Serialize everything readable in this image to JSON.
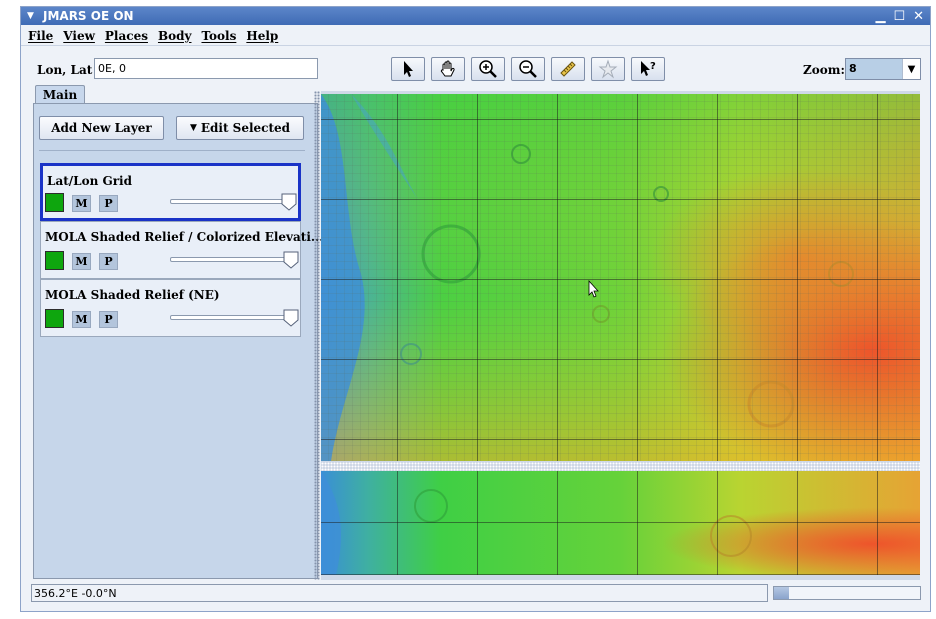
{
  "window": {
    "title": "JMARS OE ON"
  },
  "menu": [
    "File",
    "View",
    "Places",
    "Body",
    "Tools",
    "Help"
  ],
  "location": {
    "label": "Lon, Lat",
    "value": "0E, 0"
  },
  "toolbar": {
    "tools": [
      {
        "icon": "select-arrow-icon"
      },
      {
        "icon": "pan-hand-icon"
      },
      {
        "icon": "zoom-in-icon"
      },
      {
        "icon": "zoom-out-icon"
      },
      {
        "icon": "ruler-icon"
      },
      {
        "icon": "star-icon"
      },
      {
        "icon": "help-pointer-icon"
      }
    ]
  },
  "zoom": {
    "label": "Zoom:",
    "value": "8"
  },
  "tabs": {
    "main": "Main"
  },
  "panel": {
    "add_layer": "Add New Layer",
    "edit_selected": "Edit Selected",
    "layers": [
      {
        "name": "Lat/Lon Grid",
        "m": "M",
        "p": "P",
        "selected": true
      },
      {
        "name": "MOLA Shaded Relief / Colorized Elevati...",
        "m": "M",
        "p": "P",
        "selected": false
      },
      {
        "name": "MOLA Shaded Relief (NE)",
        "m": "M",
        "p": "P",
        "selected": false
      }
    ]
  },
  "status": {
    "coords": "356.2°E   -0.0°N",
    "progress": 0.1
  },
  "colors": {
    "layer_swatch": "#0ea60e",
    "selection_border": "#1a33c7",
    "title_bar": "#4a75bd"
  }
}
